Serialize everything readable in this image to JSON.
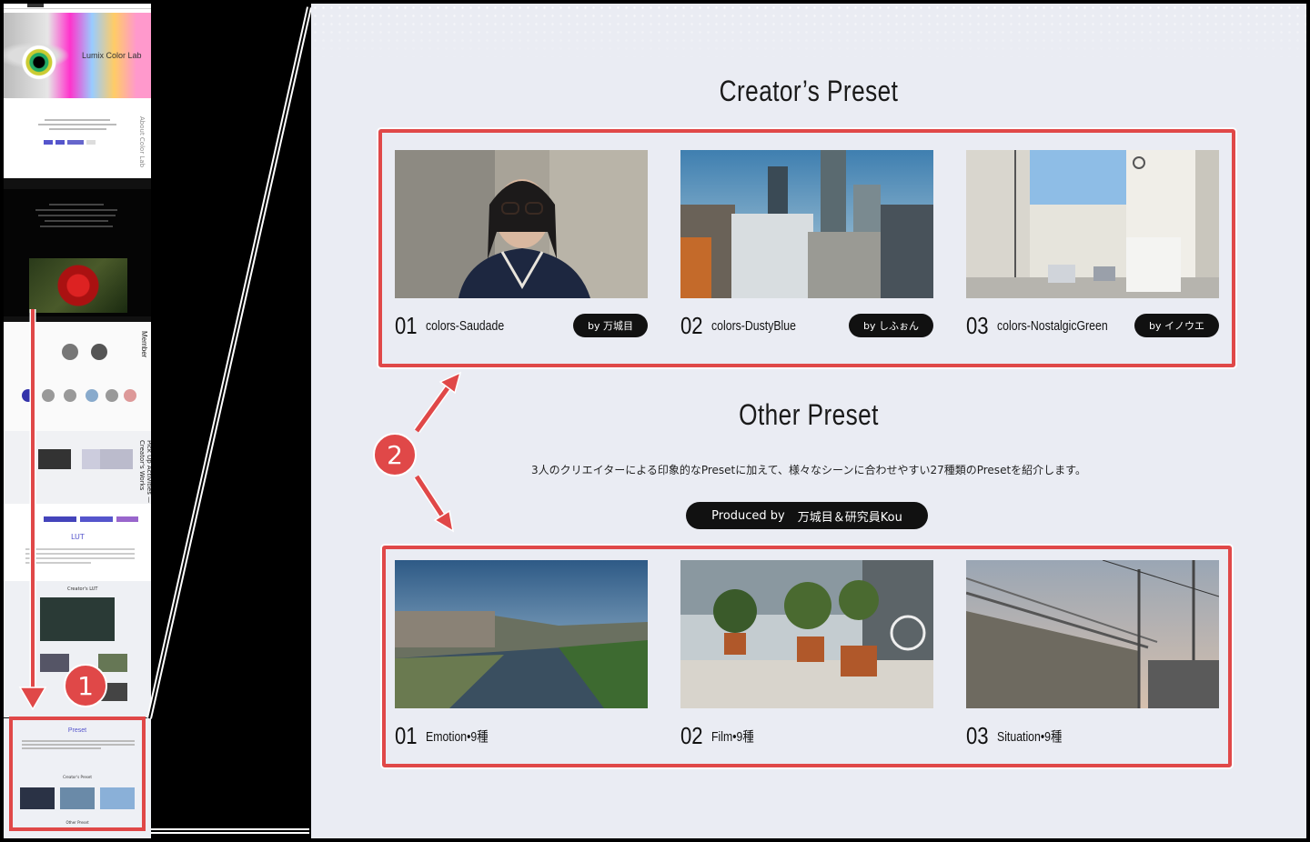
{
  "thumbnail": {
    "hero_title": "Lumix Color Lab",
    "hero_side_label": "About Color Lab",
    "member_label": "Member",
    "pickup_label": "Pick Up Activities — Creator's Works",
    "works_heading": "LUT",
    "lut_heading": "Creator's LUT",
    "preset_heading": "Preset",
    "creators_preset_small": "Creator's Preset",
    "other_preset_small": "Other Preset"
  },
  "markers": {
    "one": "1",
    "two": "2"
  },
  "creators": {
    "title": "Creator’s Preset",
    "cards": [
      {
        "num": "01",
        "name": "colors-Saudade",
        "by": "by 万城目"
      },
      {
        "num": "02",
        "name": "colors-DustyBlue",
        "by": "by しふぉん"
      },
      {
        "num": "03",
        "name": "colors-NostalgicGreen",
        "by": "by イノウエ"
      }
    ]
  },
  "other": {
    "title": "Other Preset",
    "description": "3人のクリエイターによる印象的なPresetに加えて、様々なシーンに合わせやすい27種類のPresetを紹介します。",
    "produced_by_label": "Produced by",
    "produced_by_names": "万城目＆研究員Kou",
    "cards": [
      {
        "num": "01",
        "name": "Emotion•9種"
      },
      {
        "num": "02",
        "name": "Film•9種"
      },
      {
        "num": "03",
        "name": "Situation•9種"
      }
    ]
  },
  "colors": {
    "callout": "#e04848",
    "panel_bg": "#eaecf3",
    "pill": "#111111"
  }
}
